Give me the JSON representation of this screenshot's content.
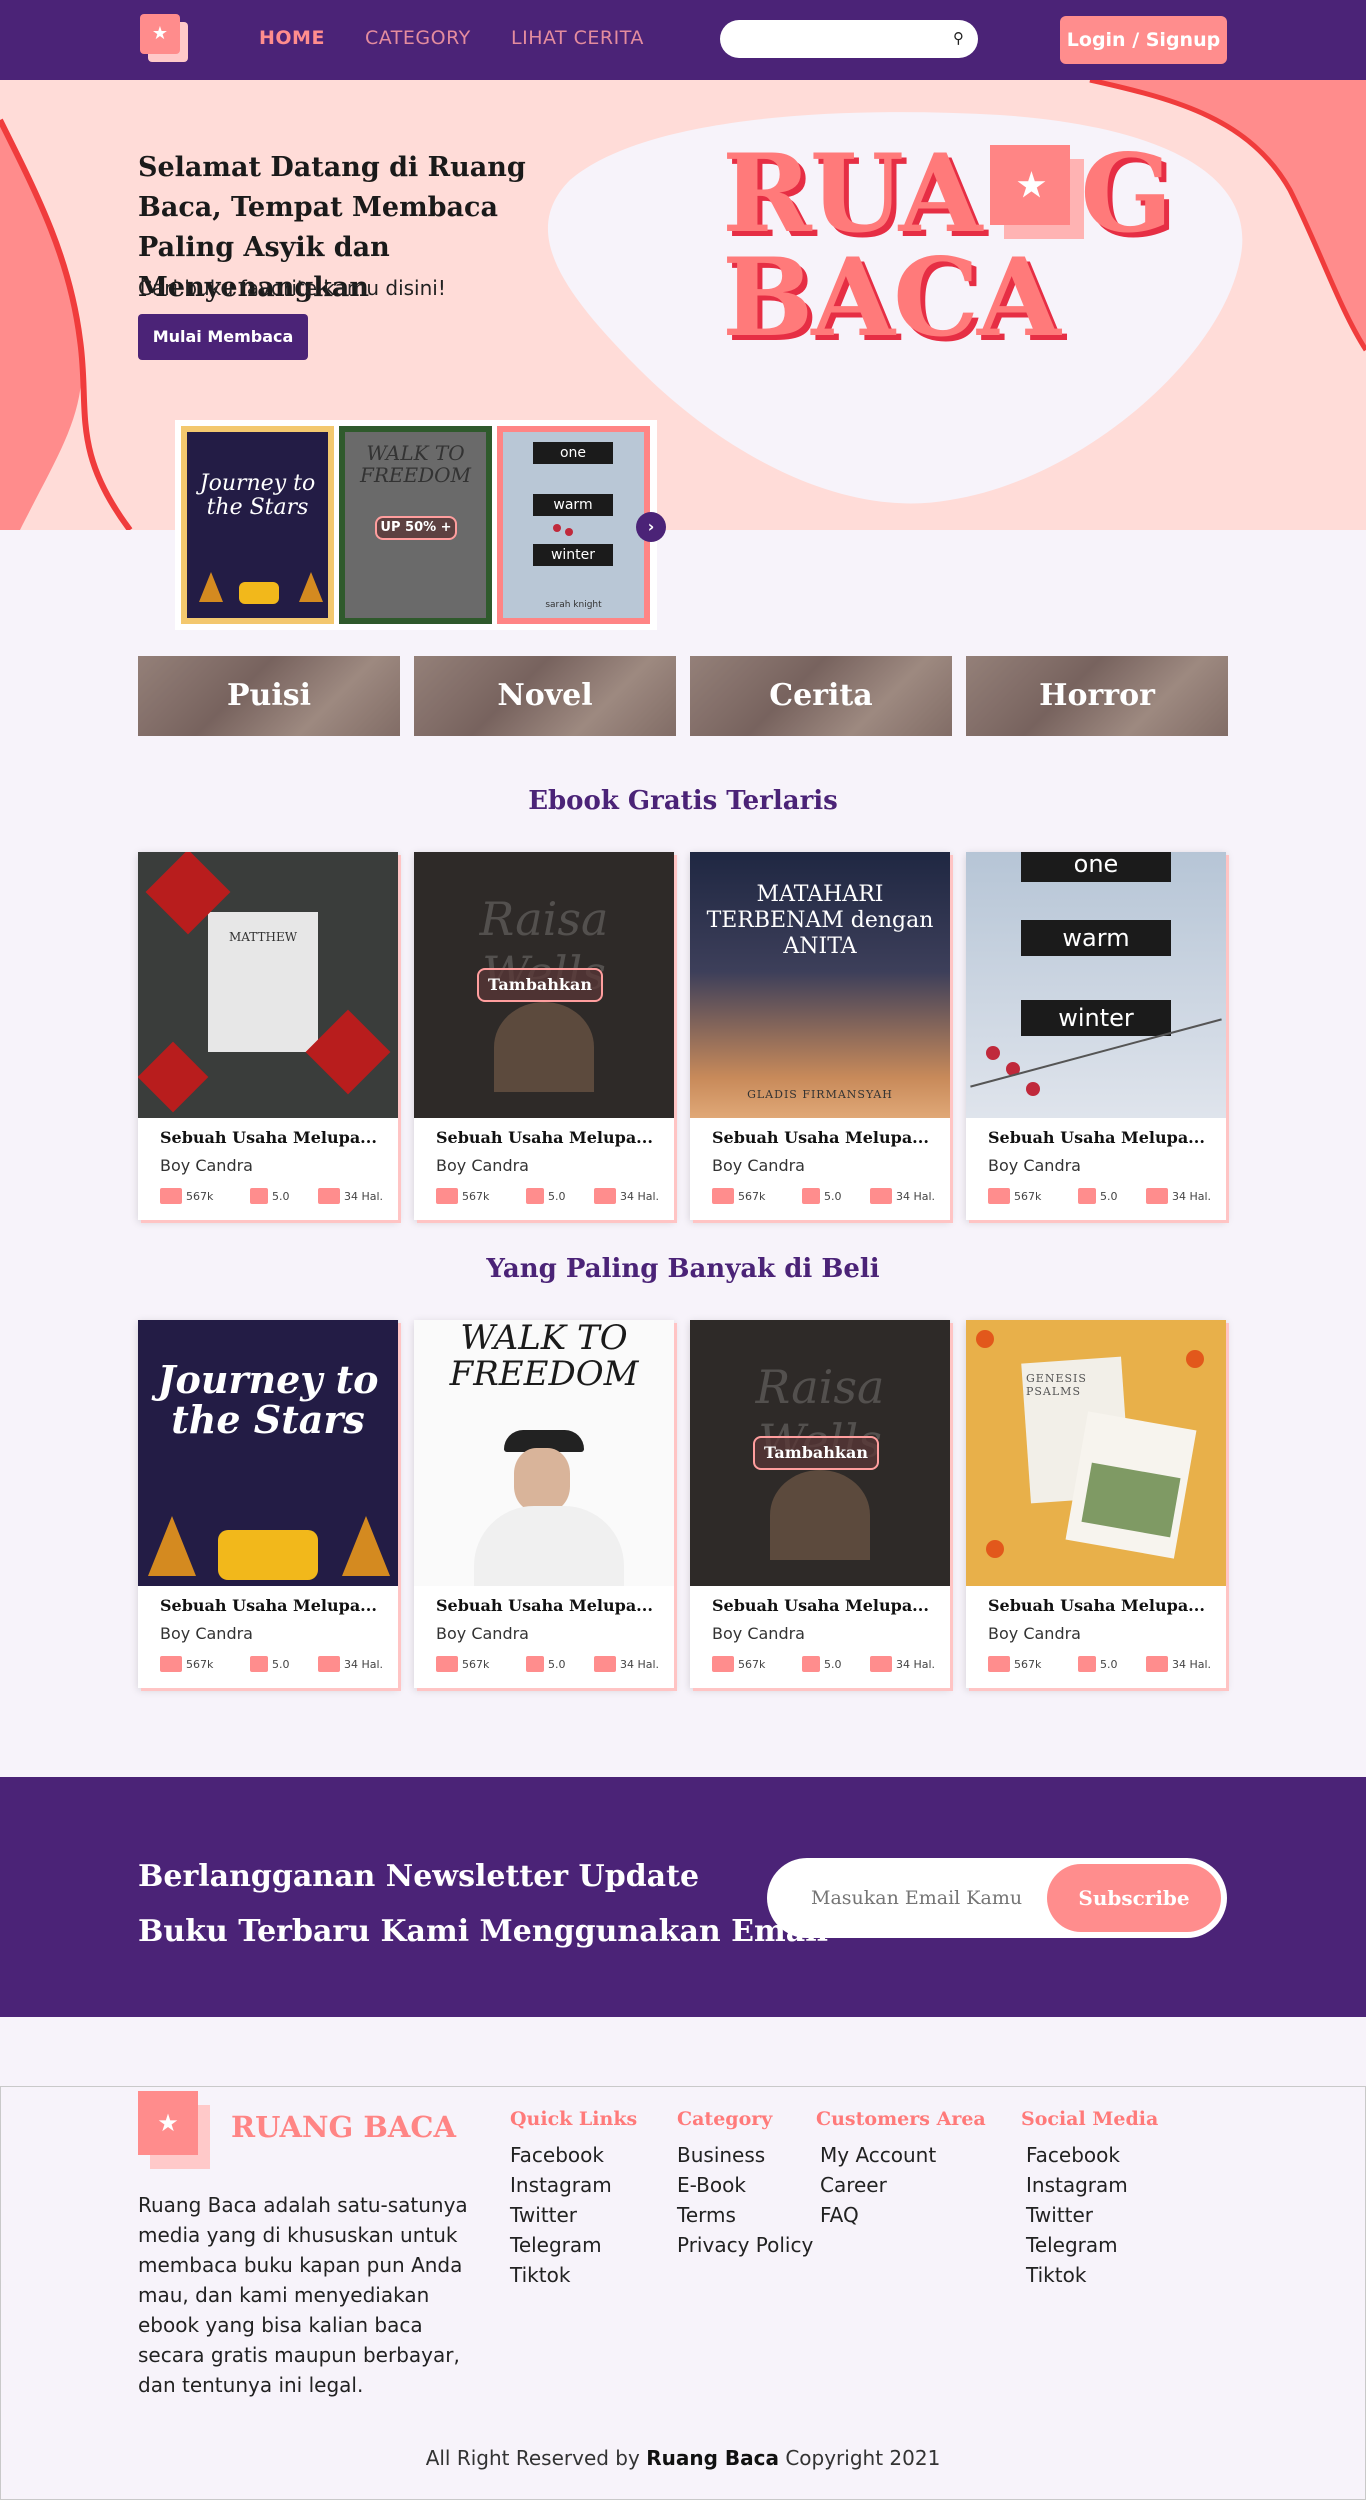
{
  "nav": {
    "links": [
      "HOME",
      "CATEGORY",
      "LIHAT CERITA"
    ],
    "search_placeholder": "",
    "login_label": "Login / Signup"
  },
  "hero": {
    "title": "Selamat Datang di Ruang Baca, Tempat Membaca Paling Asyik dan Menyenangkan",
    "subtitle": "Cari buku favorite kamu disini!",
    "cta_label": "Mulai Membaca",
    "logo_line1_a": "RUA",
    "logo_line1_b": "G",
    "logo_line2": "BACA",
    "carousel": [
      {
        "title": "Journey to the Stars",
        "label": ""
      },
      {
        "title": "WALK TO FREEDOM",
        "label": "UP 50%"
      },
      {
        "title": "one warm winter",
        "label": "",
        "author": "sarah knight"
      }
    ]
  },
  "categories": [
    "Puisi",
    "Novel",
    "Cerita",
    "Horror"
  ],
  "sections": [
    {
      "title": "Ebook Gratis Terlaris",
      "books": [
        {
          "cover": "MATTHEW",
          "title": "Sebuah Usaha Melupa...",
          "author": "Boy Candra",
          "reads": "567k",
          "rating": "5.0",
          "pages": "34 Hal.",
          "overlay": ""
        },
        {
          "cover": "Raisa Wells",
          "title": "Sebuah Usaha Melupa...",
          "author": "Boy Candra",
          "reads": "567k",
          "rating": "5.0",
          "pages": "34 Hal.",
          "overlay": "Tambahkan"
        },
        {
          "cover": "MATAHARI TERBENAM dengan ANITA",
          "cover_author": "GLADIS FIRMANSYAH",
          "title": "Sebuah Usaha Melupa...",
          "author": "Boy Candra",
          "reads": "567k",
          "rating": "5.0",
          "pages": "34 Hal.",
          "overlay": ""
        },
        {
          "cover": "one warm winter",
          "title": "Sebuah Usaha Melupa...",
          "author": "Boy Candra",
          "reads": "567k",
          "rating": "5.0",
          "pages": "34 Hal.",
          "overlay": ""
        }
      ]
    },
    {
      "title": "Yang Paling Banyak di Beli",
      "books": [
        {
          "cover": "Journey to the Stars",
          "title": "Sebuah Usaha Melupa...",
          "author": "Boy Candra",
          "reads": "567k",
          "rating": "5.0",
          "pages": "34 Hal.",
          "overlay": ""
        },
        {
          "cover": "WALK TO FREEDOM",
          "title": "Sebuah Usaha Melupa...",
          "author": "Boy Candra",
          "reads": "567k",
          "rating": "5.0",
          "pages": "34 Hal.",
          "overlay": ""
        },
        {
          "cover": "Raisa Wells",
          "title": "Sebuah Usaha Melupa...",
          "author": "Boy Candra",
          "reads": "567k",
          "rating": "5.0",
          "pages": "34 Hal.",
          "overlay": "Tambahkan"
        },
        {
          "cover": "GENESIS PSALMS",
          "title": "Sebuah Usaha Melupa...",
          "author": "Boy Candra",
          "reads": "567k",
          "rating": "5.0",
          "pages": "34 Hal.",
          "overlay": ""
        }
      ]
    }
  ],
  "newsletter": {
    "line1": "Berlangganan Newsletter Update",
    "line2": "Buku Terbaru Kami Menggunakan Email",
    "placeholder": "Masukan Email Kamu",
    "button": "Subscribe"
  },
  "footer": {
    "brand": "RUANG BACA",
    "description": "Ruang Baca adalah satu-satunya media yang di khususkan untuk membaca buku kapan pun Anda mau, dan kami menyediakan ebook yang bisa kalian baca secara gratis maupun berbayar, dan tentunya ini legal.",
    "columns": [
      {
        "title": "Quick Links",
        "items": [
          "Facebook",
          "Instagram",
          "Twitter",
          "Telegram",
          "Tiktok"
        ]
      },
      {
        "title": "Category",
        "items": [
          "Business",
          "E-Book",
          "Terms",
          "Privacy Policy"
        ]
      },
      {
        "title": "Customers Area",
        "items": [
          "My Account",
          "Career",
          "FAQ"
        ]
      },
      {
        "title": "Social Media",
        "items": [
          "Facebook",
          "Instagram",
          "Twitter",
          "Telegram",
          "Tiktok"
        ]
      }
    ],
    "copyright_prefix": "All Right Reserved by",
    "copyright_brand": "Ruang Baca",
    "copyright_suffix": "Copyright 2021"
  }
}
